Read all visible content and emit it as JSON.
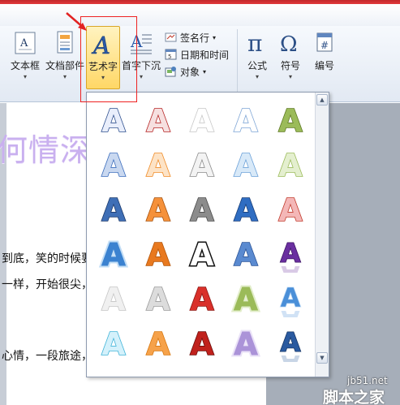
{
  "ribbon": {
    "textbox_label": "文本框",
    "quickparts_label": "文档部件",
    "wordart_label": "艺术字",
    "dropcap_label": "首字下沉",
    "signature_label": "签名行",
    "datetime_label": "日期和时间",
    "object_label": "对象",
    "equation_label": "公式",
    "symbol_label": "符号",
    "number_label": "编号",
    "dropdown_glyph": "▾",
    "icons": [
      "textbox-icon",
      "quickparts-icon",
      "wordart-icon",
      "dropcap-icon",
      "signature-icon",
      "datetime-icon",
      "object-icon",
      "equation-icon",
      "symbol-icon",
      "number-icon"
    ]
  },
  "document": {
    "wordart_fragment": "何情深",
    "lines": [
      "到底，笑的时候要",
      "一样，开始很尖，",
      "心情，一段旅途，"
    ]
  },
  "gallery": {
    "letter": "A",
    "styles": [
      {
        "fill": "#e9eefb",
        "stroke": "#2e4f8e",
        "style": "outline"
      },
      {
        "fill": "#f6e0e0",
        "stroke": "#b52323",
        "style": "outline"
      },
      {
        "fill": "#ffffff",
        "stroke": "#c8c8c8",
        "style": "outline"
      },
      {
        "fill": "#ffffff",
        "stroke": "#7fa6d6",
        "style": "outline"
      },
      {
        "fill": "#9bbb59",
        "stroke": "#5f7a24",
        "style": "solid"
      },
      {
        "fill": "#c9d8f0",
        "stroke": "#3a6cbc",
        "style": "soft"
      },
      {
        "fill": "#fde3c6",
        "stroke": "#f08a24",
        "style": "soft"
      },
      {
        "fill": "#f3f3f3",
        "stroke": "#8a8a8a",
        "style": "soft"
      },
      {
        "fill": "#d8e9f8",
        "stroke": "#6aa0d8",
        "style": "soft"
      },
      {
        "fill": "#e4efcf",
        "stroke": "#9bbb59",
        "style": "soft"
      },
      {
        "fill": "#3f6fb6",
        "stroke": "#1c3a6c",
        "style": "bevel"
      },
      {
        "fill": "#f5913a",
        "stroke": "#a8520c",
        "style": "bevel"
      },
      {
        "fill": "#8c8c8c",
        "stroke": "#4a4a4a",
        "style": "bevel"
      },
      {
        "fill": "#2f6dc2",
        "stroke": "#173d78",
        "style": "bevel"
      },
      {
        "fill": "#f4b7b7",
        "stroke": "#c0392b",
        "style": "bevel"
      },
      {
        "fill": "#3b82d0",
        "stroke": "#a9cff2",
        "style": "glow"
      },
      {
        "fill": "#e8791f",
        "stroke": "#b4560a",
        "style": "solid"
      },
      {
        "fill": "#ffffff",
        "stroke": "#111111",
        "style": "outline-thick"
      },
      {
        "fill": "#5a8ad0",
        "stroke": "#2c5598",
        "style": "solid"
      },
      {
        "fill": "#6a2fa0",
        "stroke": "#3f1566",
        "style": "reflect"
      },
      {
        "fill": "#f0f0f0",
        "stroke": "#c4c4c4",
        "style": "soft"
      },
      {
        "fill": "#dcdcdc",
        "stroke": "#9a9a9a",
        "style": "soft"
      },
      {
        "fill": "#d9302a",
        "stroke": "#8e1612",
        "style": "bevel"
      },
      {
        "fill": "#9bbb59",
        "stroke": "#d7e6b5",
        "style": "glow"
      },
      {
        "fill": "#4a8fd8",
        "stroke": "#c1dcf6",
        "style": "reflect"
      },
      {
        "fill": "#d4f1fb",
        "stroke": "#3fb3d8",
        "style": "outline"
      },
      {
        "fill": "#f6a24a",
        "stroke": "#d7770f",
        "style": "soft"
      },
      {
        "fill": "#c0211c",
        "stroke": "#6b0d0a",
        "style": "bevel"
      },
      {
        "fill": "#ab93d8",
        "stroke": "#e2d7f5",
        "style": "glow"
      },
      {
        "fill": "#2a5aa0",
        "stroke": "#163666",
        "style": "reflect"
      }
    ]
  },
  "scrollbar": {
    "up": "▲",
    "down": "▼"
  },
  "watermark": {
    "site": "jb51.net",
    "name": "脚本之家"
  },
  "colors": {
    "accent_red": "#e22222",
    "highlight": "#ffd766"
  }
}
